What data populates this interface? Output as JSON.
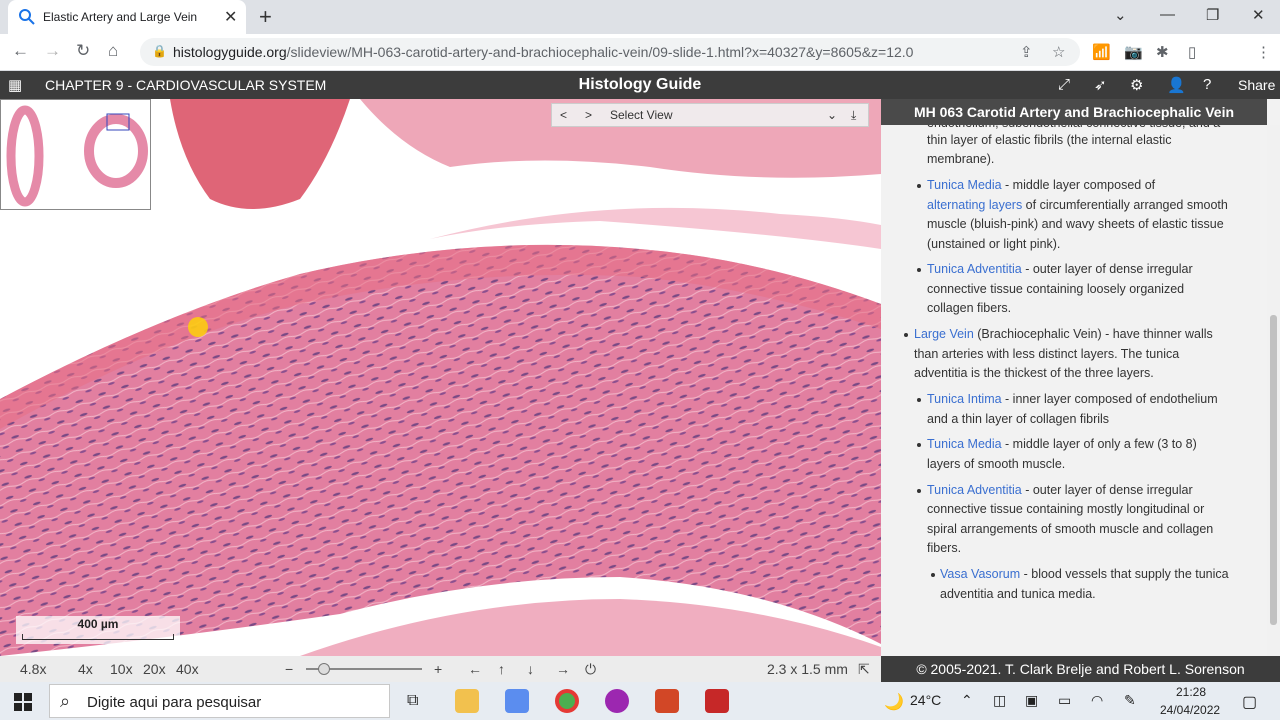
{
  "browser": {
    "tab_title": "Elastic Artery and Large Vein",
    "url_domain": "histologyguide.org",
    "url_path": "/slideview/MH-063-carotid-artery-and-brachiocephalic-vein/09-slide-1.html?x=40327&y=8605&z=12.0"
  },
  "site": {
    "chapter": "CHAPTER 9 - CARDIOVASCULAR SYSTEM",
    "title": "Histology Guide",
    "share_label": "Share"
  },
  "viewer": {
    "select_view": "Select View",
    "scale_label": "400 µm",
    "zoom_current": "4.8x",
    "zoom_levels": [
      "4x",
      "10x",
      "20x",
      "40x"
    ],
    "field_size": "2.3 x 1.5 mm",
    "zoom_slider_fraction": 0.12
  },
  "panel": {
    "header": "MH 063 Carotid Artery and Brachiocephalic Vein",
    "cut_line": "endothelium, subendothelial connective tissue, and a",
    "intima_tail_1": "thin layer of elastic fibrils (the internal elastic",
    "intima_tail_2": "membrane).",
    "artery_media_link": "Tunica Media",
    "artery_media_text1": " - middle layer composed of",
    "artery_media_link2": "alternating layers",
    "artery_media_text2": " of circumferentially arranged smooth",
    "artery_media_text3": "muscle (bluish-pink) and wavy sheets of elastic tissue",
    "artery_media_text4": "(unstained or light pink).",
    "artery_adv_link": "Tunica Adventitia",
    "artery_adv_text1": " - outer layer of dense irregular",
    "artery_adv_text2": "connective tissue containing loosely organized",
    "artery_adv_text3": "collagen fibers.",
    "vein_link": "Large Vein",
    "vein_text1": " (Brachiocephalic Vein) - have thinner walls",
    "vein_text2": "than arteries with less distinct layers. The tunica",
    "vein_text3": "adventitia is the thickest of the three layers.",
    "vein_intima_link": "Tunica Intima",
    "vein_intima_text1": " - inner layer composed of endothelium",
    "vein_intima_text2": "and a thin layer of collagen fibrils",
    "vein_media_link": "Tunica Media",
    "vein_media_text1": " - middle layer of only a few (3 to 8)",
    "vein_media_text2": "layers of smooth muscle.",
    "vein_adv_link": "Tunica Adventitia",
    "vein_adv_text1": " - outer layer of dense irregular",
    "vein_adv_text2": "connective tissue containing mostly longitudinal or",
    "vein_adv_text3": "spiral arrangements of smooth muscle and collagen",
    "vein_adv_text4": "fibers.",
    "vasa_link": "Vasa Vasorum",
    "vasa_text1": " - blood vessels that supply the tunica",
    "vasa_text2": "adventitia and tunica media."
  },
  "footer": {
    "copyright": "© 2005-2021. T. Clark Brelje and Robert L. Sorenson"
  },
  "taskbar": {
    "search_placeholder": "Digite aqui para pesquisar",
    "temperature": "24°C",
    "time": "21:28",
    "date": "24/04/2022"
  },
  "colors": {
    "tissue": "#e07a9c",
    "link": "#3a6fd0",
    "header_dark": "#3c3c3c"
  }
}
